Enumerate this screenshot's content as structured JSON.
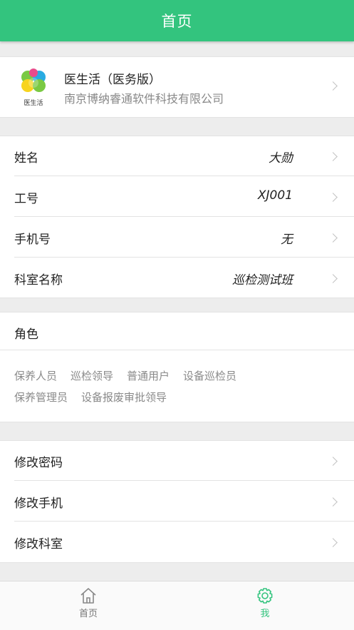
{
  "header": {
    "title": "首页"
  },
  "app": {
    "name": "医生活（医务版）",
    "company": "南京博纳睿通软件科技有限公司",
    "logo_text": "医生活",
    "logo_colors": {
      "green": "#7ac943",
      "yellow": "#f7d41f",
      "pink": "#e94b8c",
      "teal": "#29abe2"
    }
  },
  "info": [
    {
      "label": "姓名",
      "value": "大勋"
    },
    {
      "label": "工号",
      "value": "XJ001"
    },
    {
      "label": "手机号",
      "value": "无"
    },
    {
      "label": "科室名称",
      "value": "巡检测试班"
    }
  ],
  "roles": {
    "title": "角色",
    "tags": [
      "保养人员",
      "巡检领导",
      "普通用户",
      "设备巡检员",
      "保养管理员",
      "设备报废审批领导"
    ]
  },
  "actions": [
    {
      "label": "修改密码"
    },
    {
      "label": "修改手机"
    },
    {
      "label": "修改科室"
    }
  ],
  "bottom_nav": {
    "home_label": "首页",
    "me_label": "我",
    "active": "我",
    "accent": "#33c47e"
  }
}
